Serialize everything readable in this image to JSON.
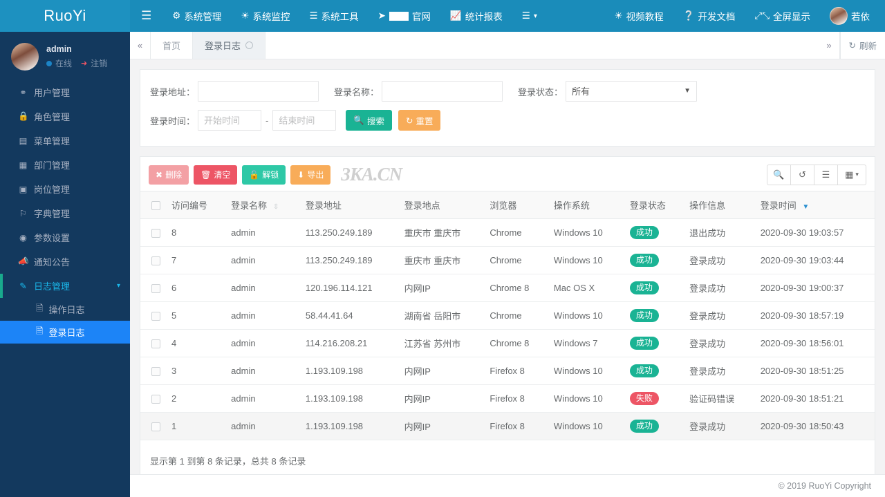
{
  "brand": {
    "title": "RuoYi"
  },
  "topnav": {
    "hamburger_icon": "hamburger-icon",
    "items": [
      {
        "label": "系统管理",
        "icon": "gear-icon"
      },
      {
        "label": "系统监控",
        "icon": "video-icon"
      },
      {
        "label": "系统工具",
        "icon": "list-icon"
      },
      {
        "label": "官网",
        "icon": "location-arrow-icon",
        "redacted": true
      },
      {
        "label": "统计报表",
        "icon": "chart-icon"
      },
      {
        "label": "",
        "icon": "bars-caret-icon"
      }
    ],
    "right_items": [
      {
        "label": "视频教程",
        "icon": "video-icon"
      },
      {
        "label": "开发文档",
        "icon": "question-circle-icon"
      },
      {
        "label": "全屏显示",
        "icon": "expand-icon"
      }
    ],
    "user": {
      "name": "若依",
      "avatar": "avatar"
    }
  },
  "sidebar": {
    "profile": {
      "name": "admin",
      "status": "在线",
      "logout": "注销"
    },
    "items": [
      {
        "label": "用户管理",
        "icon": "user-icon"
      },
      {
        "label": "角色管理",
        "icon": "lock-icon"
      },
      {
        "label": "菜单管理",
        "icon": "menu-list-icon"
      },
      {
        "label": "部门管理",
        "icon": "sitemap-icon"
      },
      {
        "label": "岗位管理",
        "icon": "id-card-icon"
      },
      {
        "label": "字典管理",
        "icon": "bookmark-icon"
      },
      {
        "label": "参数设置",
        "icon": "cog-icon"
      },
      {
        "label": "通知公告",
        "icon": "bullhorn-icon"
      },
      {
        "label": "日志管理",
        "icon": "edit-icon",
        "expanded": true
      }
    ],
    "submenu": [
      {
        "label": "操作日志",
        "icon": "file-icon",
        "active": false
      },
      {
        "label": "登录日志",
        "icon": "file-chart-icon",
        "active": true
      }
    ]
  },
  "tabbar": {
    "collapse_left_icon": "double-chevron-left-icon",
    "collapse_right_icon": "double-chevron-right-icon",
    "tabs": [
      {
        "label": "首页",
        "active": false,
        "closable": false
      },
      {
        "label": "登录日志",
        "active": true,
        "closable": true
      }
    ],
    "refresh_label": "刷新",
    "refresh_icon": "refresh-icon"
  },
  "search": {
    "addr_label": "登录地址：",
    "addr_value": "",
    "addr_placeholder": "",
    "name_label": "登录名称：",
    "name_value": "",
    "name_placeholder": "",
    "status_label": "登录状态：",
    "status_value": "所有",
    "status_options": [
      "所有"
    ],
    "time_label": "登录时间：",
    "time_start_placeholder": "开始时间",
    "time_start_value": "",
    "time_end_placeholder": "结束时间",
    "time_end_value": "",
    "time_separator": "-",
    "search_button": "搜索",
    "reset_button": "重置"
  },
  "toolbar": {
    "delete_label": "删除",
    "clear_label": "清空",
    "unlock_label": "解锁",
    "export_label": "导出",
    "watermark": "3KA.CN",
    "icons": [
      "search-icon",
      "refresh-icon",
      "columns-list-icon",
      "grid-dropdown-icon"
    ]
  },
  "table": {
    "columns": [
      {
        "key": "id",
        "label": "访问编号",
        "sort": "none"
      },
      {
        "key": "name",
        "label": "登录名称",
        "sort": "both"
      },
      {
        "key": "addr",
        "label": "登录地址",
        "sort": "none"
      },
      {
        "key": "loc",
        "label": "登录地点",
        "sort": "none"
      },
      {
        "key": "browser",
        "label": "浏览器",
        "sort": "none"
      },
      {
        "key": "os",
        "label": "操作系统",
        "sort": "none"
      },
      {
        "key": "status",
        "label": "登录状态",
        "sort": "none"
      },
      {
        "key": "msg",
        "label": "操作信息",
        "sort": "none"
      },
      {
        "key": "time",
        "label": "登录时间",
        "sort": "desc"
      }
    ],
    "rows": [
      {
        "id": "8",
        "name": "admin",
        "addr": "113.250.249.189",
        "loc": "重庆市 重庆市",
        "browser": "Chrome",
        "os": "Windows 10",
        "status": "成功",
        "status_kind": "ok",
        "msg": "退出成功",
        "time": "2020-09-30 19:03:57",
        "hover": false
      },
      {
        "id": "7",
        "name": "admin",
        "addr": "113.250.249.189",
        "loc": "重庆市 重庆市",
        "browser": "Chrome",
        "os": "Windows 10",
        "status": "成功",
        "status_kind": "ok",
        "msg": "登录成功",
        "time": "2020-09-30 19:03:44",
        "hover": false
      },
      {
        "id": "6",
        "name": "admin",
        "addr": "120.196.114.121",
        "loc": "内网IP",
        "browser": "Chrome 8",
        "os": "Mac OS X",
        "status": "成功",
        "status_kind": "ok",
        "msg": "登录成功",
        "time": "2020-09-30 19:00:37",
        "hover": false
      },
      {
        "id": "5",
        "name": "admin",
        "addr": "58.44.41.64",
        "loc": "湖南省 岳阳市",
        "browser": "Chrome",
        "os": "Windows 10",
        "status": "成功",
        "status_kind": "ok",
        "msg": "登录成功",
        "time": "2020-09-30 18:57:19",
        "hover": false
      },
      {
        "id": "4",
        "name": "admin",
        "addr": "114.216.208.21",
        "loc": "江苏省 苏州市",
        "browser": "Chrome 8",
        "os": "Windows 7",
        "status": "成功",
        "status_kind": "ok",
        "msg": "登录成功",
        "time": "2020-09-30 18:56:01",
        "hover": false
      },
      {
        "id": "3",
        "name": "admin",
        "addr": "1.193.109.198",
        "loc": "内网IP",
        "browser": "Firefox 8",
        "os": "Windows 10",
        "status": "成功",
        "status_kind": "ok",
        "msg": "登录成功",
        "time": "2020-09-30 18:51:25",
        "hover": false
      },
      {
        "id": "2",
        "name": "admin",
        "addr": "1.193.109.198",
        "loc": "内网IP",
        "browser": "Firefox 8",
        "os": "Windows 10",
        "status": "失败",
        "status_kind": "fail",
        "msg": "验证码错误",
        "time": "2020-09-30 18:51:21",
        "hover": false
      },
      {
        "id": "1",
        "name": "admin",
        "addr": "1.193.109.198",
        "loc": "内网IP",
        "browser": "Firefox 8",
        "os": "Windows 10",
        "status": "成功",
        "status_kind": "ok",
        "msg": "登录成功",
        "time": "2020-09-30 18:50:43",
        "hover": true
      }
    ],
    "summary": "显示第 1 到第 8 条记录，总共 8 条记录"
  },
  "footer": {
    "copyright": "© 2019 RuoYi Copyright"
  },
  "colors": {
    "nav_blue": "#1a8cba",
    "brand_blue": "#1d91c0",
    "sidebar_dark": "#13395e",
    "active_blue": "#1c84f7",
    "success_green": "#1ab394",
    "danger_red": "#ed5565",
    "warning_orange": "#f8ac59"
  }
}
